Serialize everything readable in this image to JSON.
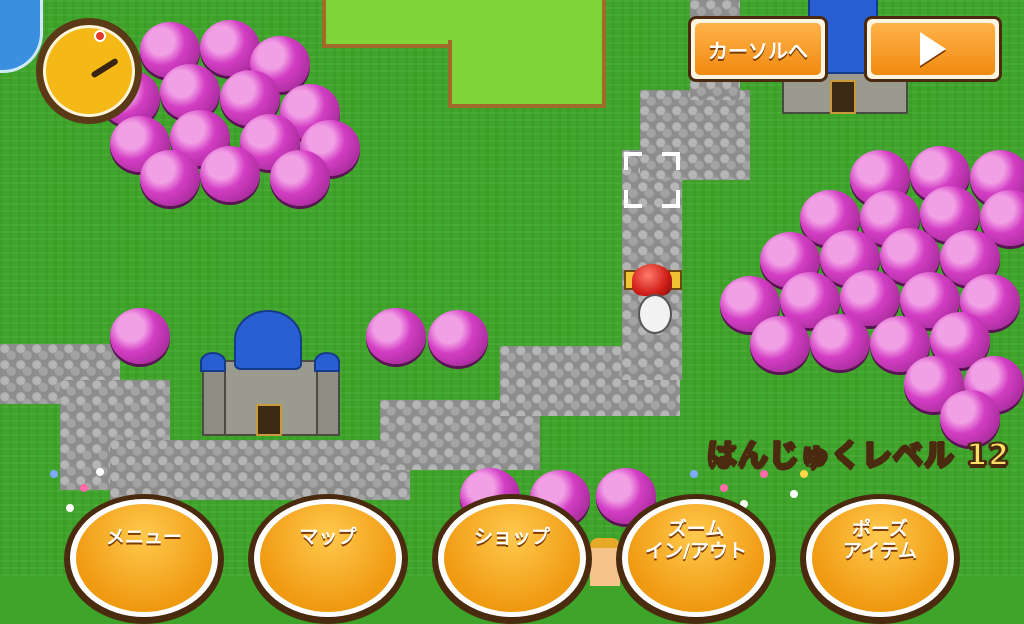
{
  "top_buttons": {
    "cursor_label": "カーソルへ",
    "play_icon": "play-icon"
  },
  "status": {
    "level_text": "はんじゅくレベル 12"
  },
  "bottom_menu": [
    {
      "id": "menu",
      "lines": [
        "メニュー"
      ]
    },
    {
      "id": "map",
      "lines": [
        "マップ"
      ]
    },
    {
      "id": "shop",
      "lines": [
        "ショップ"
      ]
    },
    {
      "id": "zoom",
      "lines": [
        "ズーム",
        "イン/アウト"
      ]
    },
    {
      "id": "pause",
      "lines": [
        "ポーズ",
        "アイテム"
      ]
    }
  ],
  "icons": {
    "timer": "clock-icon",
    "cursor": "selection-cursor-icon",
    "player": "hero-sprite"
  },
  "colors": {
    "accent_orange": "#f5a623",
    "outline_brown": "#4a2b10",
    "grass": "#3fa52a",
    "forest_pink": "#d33ec4"
  }
}
